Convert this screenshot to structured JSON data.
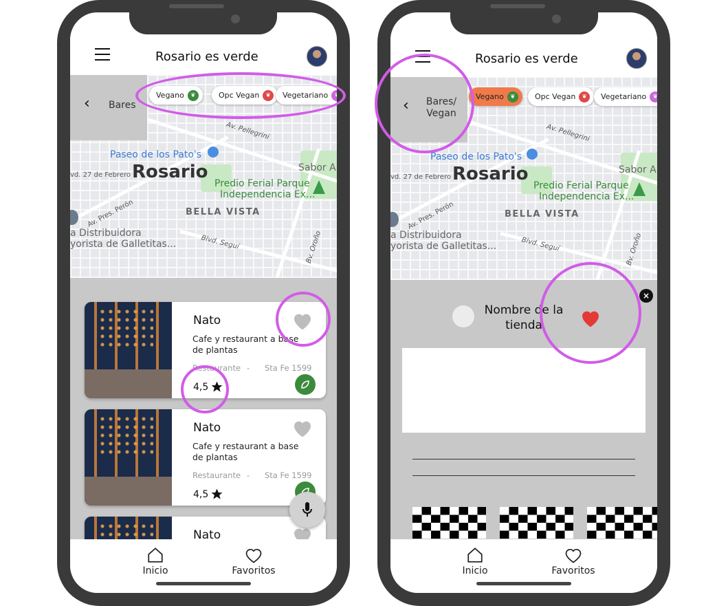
{
  "left": {
    "title": "Rosario es verde",
    "back_label": "Bares",
    "chips": [
      {
        "label": "Vegano",
        "color": "#3c8a3c"
      },
      {
        "label": "Opc Vegan",
        "color": "#e04848"
      },
      {
        "label": "Vegetariano",
        "color": "#cc66dd"
      }
    ],
    "map": {
      "city": "Rosario",
      "paseo": "Paseo de los Pato's",
      "predio_1": "Predio Ferial Parque",
      "predio_2": "Independencia Ex...",
      "sabor": "Sabor A",
      "bella": "BELLA VISTA",
      "pellegrini": "Av. Pellegrini",
      "febrero": "vd. 27 de Febrero",
      "peron": "Av. Pres. Perón",
      "distrib_1": "a Distribuidora",
      "distrib_2": "yorista de Galletitas...",
      "segui": "Blvd. Seguí",
      "orono": "Bv. Oroño"
    },
    "cards": [
      {
        "name": "Nato",
        "desc": "Cafe y restaurant a base de plantas",
        "type": "Restaurante",
        "sep": "-",
        "address": "Sta Fe 1599",
        "rating": "4,5"
      },
      {
        "name": "Nato",
        "desc": "Cafe y restaurant a base de plantas",
        "type": "Restaurante",
        "sep": "-",
        "address": "Sta Fe 1599",
        "rating": "4,5"
      },
      {
        "name": "Nato"
      }
    ],
    "nav": {
      "home": "Inicio",
      "favorites": "Favoritos"
    }
  },
  "right": {
    "title": "Rosario es verde",
    "back_label_1": "Bares/",
    "back_label_2": "Vegan",
    "chips": [
      {
        "label": "Vegano",
        "color": "#3c8a3c",
        "bg": "#f07a4a"
      },
      {
        "label": "Opc Vegan",
        "color": "#e04848"
      },
      {
        "label": "Vegetariano",
        "color": "#cc66dd"
      }
    ],
    "map": {
      "city": "Rosario",
      "paseo": "Paseo de los Pato's",
      "predio_1": "Predio Ferial Parque",
      "predio_2": "Independencia Ex...",
      "sabor": "Sabor A",
      "bella": "BELLA VISTA",
      "pellegrini": "Av. Pellegrini",
      "febrero": "vd. 27 de Febrero",
      "peron": "Av. Pres. Perón",
      "distrib_1": "a Distribuidora",
      "distrib_2": "yorista de Galletitas...",
      "segui": "Blvd. Seguí",
      "orono": "Bv. Oroño"
    },
    "store_name_1": "Nombre de la",
    "store_name_2": "tienda",
    "close": "×",
    "nav": {
      "home": "Inicio",
      "favorites": "Favoritos"
    }
  },
  "colors": {
    "frame": "#3a3a3a",
    "highlight": "#d15ce8",
    "heart_active": "#e53935",
    "heart_idle": "#bdbdbd",
    "green": "#3c8a3c"
  }
}
